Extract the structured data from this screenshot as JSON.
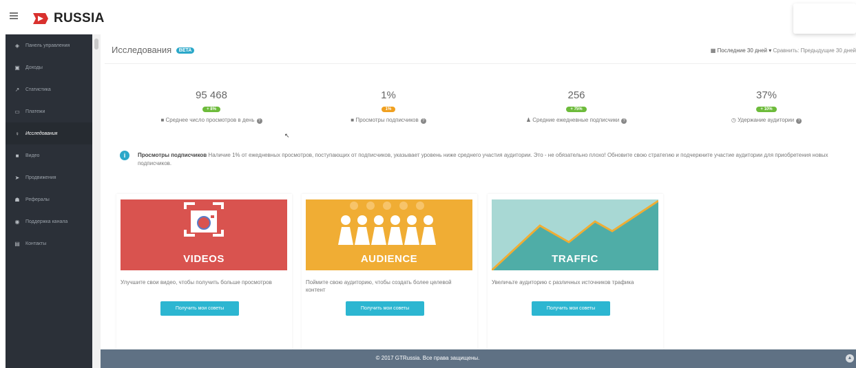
{
  "header": {
    "brand": "RUSSIA",
    "colors": {
      "brand_red": "#d9312e"
    }
  },
  "sidebar": {
    "items": [
      {
        "label": "Панель управления",
        "icon": "dashboard-icon",
        "glyph": "◈"
      },
      {
        "label": "Доходы",
        "icon": "money-icon",
        "glyph": "▣"
      },
      {
        "label": "Статистика",
        "icon": "chart-icon",
        "glyph": "↗"
      },
      {
        "label": "Платежи",
        "icon": "card-icon",
        "glyph": "▭"
      },
      {
        "label": "Исследования",
        "icon": "lightbulb-icon",
        "glyph": "♀",
        "active": true
      },
      {
        "label": "Видео",
        "icon": "video-icon",
        "glyph": "■"
      },
      {
        "label": "Продвижения",
        "icon": "rocket-icon",
        "glyph": "➤"
      },
      {
        "label": "Рефералы",
        "icon": "users-icon",
        "glyph": "☗"
      },
      {
        "label": "Поддержка канала",
        "icon": "support-icon",
        "glyph": "◉"
      },
      {
        "label": "Контакты",
        "icon": "envelope-icon",
        "glyph": "▤"
      }
    ]
  },
  "page": {
    "title": "Исследования",
    "beta": "BETA",
    "period_label": "Последние 30 дней",
    "compare_label": "Сравнить: Предыдущие 30 дней"
  },
  "stats": [
    {
      "value": "95 468",
      "badge": "+ 8%",
      "label": "Среднее число просмотров в день",
      "icon": "video-icon",
      "badge_color": "green"
    },
    {
      "value": "1%",
      "badge": "1%",
      "label": "Просмотры подписчиков",
      "icon": "video-icon",
      "badge_color": "orange"
    },
    {
      "value": "256",
      "badge": "+ 75%",
      "label": "Средние ежедневные подписчики",
      "icon": "user-plus-icon",
      "badge_color": "green"
    },
    {
      "value": "37%",
      "badge": "+ 10%",
      "label": "Удержание аудитории",
      "icon": "clock-icon",
      "badge_color": "green"
    }
  ],
  "info": {
    "title": "Просмотры подписчиков",
    "text": "Наличие 1% от ежедневных просмотров, поступающих от подписчиков, указывает уровень ниже среднего участия аудитории. Это - не обязательно плохо! Обновите свою стратегию и подчеркните участие аудитории для приобретения новых подписчиков."
  },
  "cards": [
    {
      "title": "VIDEOS",
      "desc": "Улучшите свои видео, чтобы получить больше просмотров",
      "button": "Получить мои советы",
      "color": "#d9534f"
    },
    {
      "title": "AUDIENCE",
      "desc": "Поймите свою аудиторию, чтобы создать более целевой контент",
      "button": "Получить мои советы",
      "color": "#f0ad34"
    },
    {
      "title": "TRAFFIC",
      "desc": "Увеличьте аудиторию с различных источников трафика",
      "button": "Получить мои советы",
      "color": "#4fada7"
    }
  ],
  "footer": {
    "text": "© 2017 GTRussia. Все права защищены."
  }
}
